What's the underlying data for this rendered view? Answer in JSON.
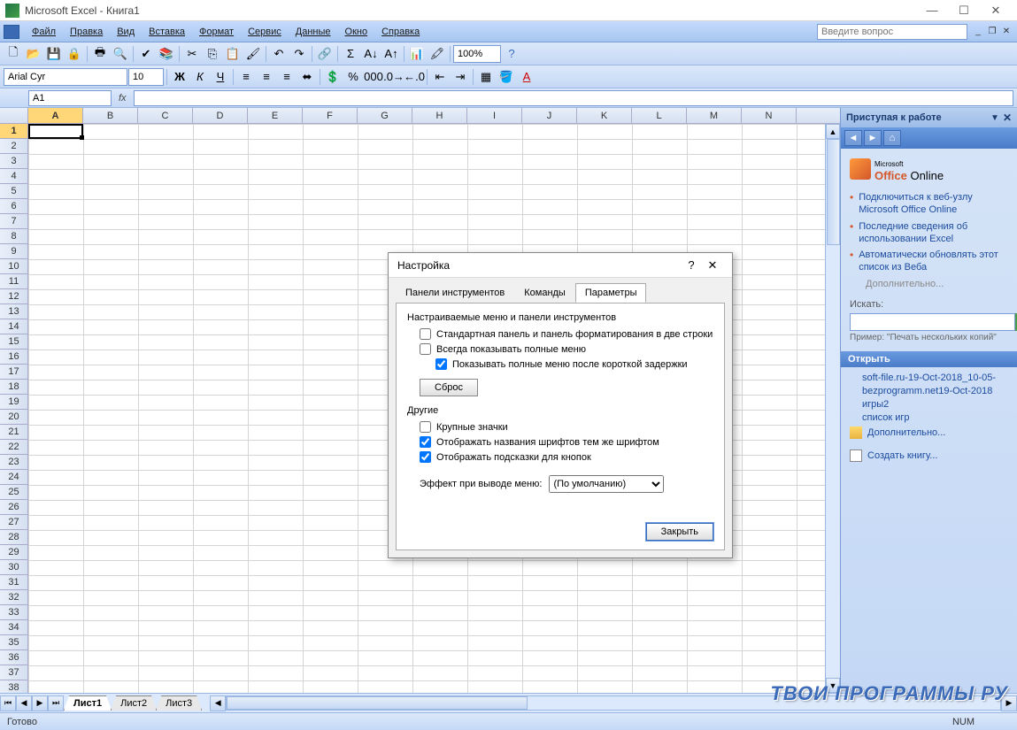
{
  "titlebar": {
    "text": "Microsoft Excel - Книга1"
  },
  "menubar": {
    "items": [
      "Файл",
      "Правка",
      "Вид",
      "Вставка",
      "Формат",
      "Сервис",
      "Данные",
      "Окно",
      "Справка"
    ],
    "ask_placeholder": "Введите вопрос"
  },
  "toolbar": {
    "font_name": "Arial Cyr",
    "font_size": "10",
    "zoom": "100%"
  },
  "namebox": {
    "value": "A1"
  },
  "formula": {
    "fx": "fx"
  },
  "columns": [
    "A",
    "B",
    "C",
    "D",
    "E",
    "F",
    "G",
    "H",
    "I",
    "J",
    "K",
    "L",
    "M",
    "N"
  ],
  "rows": [
    1,
    2,
    3,
    4,
    5,
    6,
    7,
    8,
    9,
    10,
    11,
    12,
    13,
    14,
    15,
    16,
    17,
    18,
    19,
    20,
    21,
    22,
    23,
    24,
    25,
    26,
    27,
    28,
    29,
    30,
    31,
    32,
    33,
    34,
    35,
    36,
    37,
    38
  ],
  "taskpane": {
    "title": "Приступая к работе",
    "office_label_prefix": "Microsoft",
    "office_label_bold": "Office",
    "office_label_suffix": "Online",
    "links": [
      "Подключиться к веб-узлу Microsoft Office Online",
      "Последние сведения об использовании Excel",
      "Автоматически обновлять этот список из Веба"
    ],
    "more": "Дополнительно...",
    "search_label": "Искать:",
    "search_hint": "Пример: \"Печать нескольких копий\"",
    "open_section": "Открыть",
    "recent_files": [
      "soft-file.ru-19-Oct-2018_10-05-",
      "bezprogramm.net19-Oct-2018",
      "игры2",
      "список игр"
    ],
    "more_files": "Дополнительно...",
    "create": "Создать книгу..."
  },
  "sheets": {
    "tabs": [
      "Лист1",
      "Лист2",
      "Лист3"
    ],
    "active": 0
  },
  "statusbar": {
    "ready": "Готово",
    "num": "NUM"
  },
  "dialog": {
    "title": "Настройка",
    "tabs": [
      "Панели инструментов",
      "Команды",
      "Параметры"
    ],
    "active_tab": 2,
    "group1_label": "Настраиваемые меню и панели инструментов",
    "chk_two_rows": "Стандартная панель и панель форматирования в две строки",
    "chk_full_menus": "Всегда показывать полные меню",
    "chk_delay": "Показывать полные меню после короткой задержки",
    "reset_btn": "Сброс",
    "group2_label": "Другие",
    "chk_large_icons": "Крупные значки",
    "chk_font_names": "Отображать названия шрифтов тем же шрифтом",
    "chk_tooltips": "Отображать подсказки для кнопок",
    "menu_effect_label": "Эффект при выводе меню:",
    "menu_effect_value": "(По умолчанию)",
    "close_btn": "Закрыть"
  },
  "watermark": "ТВОИ ПРОГРАММЫ РУ"
}
